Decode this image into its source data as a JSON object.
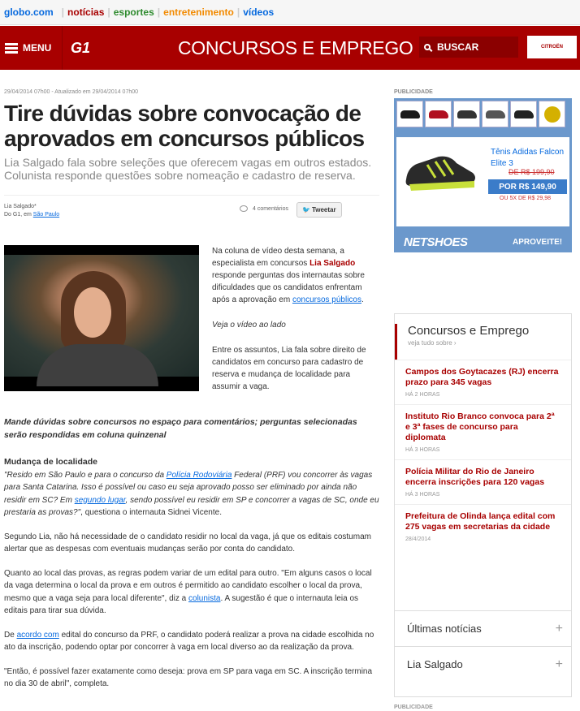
{
  "topnav": {
    "logo": "globo.com",
    "links": [
      {
        "label": "notícias",
        "color": "#a80000"
      },
      {
        "label": "esportes",
        "color": "#2d8a2d"
      },
      {
        "label": "entretenimento",
        "color": "#f28a00"
      },
      {
        "label": "vídeos",
        "color": "#0669de"
      }
    ]
  },
  "header": {
    "menu_label": "MENU",
    "brand": "G1",
    "section_title": "CONCURSOS E EMPREGO",
    "search_label": "BUSCAR",
    "ad_text": "CITROËN"
  },
  "article": {
    "date": "29/04/2014 07h00 - Atualizado em 29/04/2014 07h00",
    "title": "Tire dúvidas sobre convocação de aprovados em concursos públicos",
    "subtitle": "Lia Salgado fala sobre seleções que oferecem vagas em outros estados. Colunista responde questões sobre nomeação e cadastro de reserva.",
    "author": "Lia Salgado*",
    "source_prefix": "Do G1, em ",
    "source_city": "São Paulo",
    "comments": "4 comentários",
    "tweet": "Tweetar",
    "video_p1_a": "Na coluna de vídeo desta semana, a especialista em concursos ",
    "video_p1_name": "Lia Salgado",
    "video_p1_b": " responde perguntas dos internautas sobre dificuldades que os candidatos enfrentam após a aprovação em ",
    "video_p1_link": "concursos públicos",
    "video_p1_c": ".",
    "video_p2": "Veja o vídeo ao lado",
    "video_p3": "Entre os assuntos, Lia fala sobre direito de candidatos em concurso para cadastro de reserva e mudança de localidade para assumir a vaga.",
    "callout": "Mande dúvidas sobre concursos no espaço para comentários; perguntas selecionadas serão respondidas em coluna quinzenal",
    "h_mudanca": "Mudança de localidade",
    "q1_a": "\"Resido em São Paulo e para o concurso da ",
    "q1_link1": "Polícia Rodoviária",
    "q1_b": " Federal (PRF) vou concorrer às vagas para Santa Catarina. Isso é possível ou caso eu seja aprovado posso ser eliminado por ainda não residir em SC? Em ",
    "q1_link2": "segundo lugar",
    "q1_c": ", sendo possível eu residir em SP e concorrer a vagas de SC, onde eu prestaria as provas?\"",
    "q1_d": ", questiona o internauta Sidnei Vicente.",
    "p1": "Segundo Lia, não há necessidade de o candidato residir no local da vaga, já que os editais costumam alertar que as despesas com eventuais mudanças serão por conta do candidato.",
    "p2_a": "Quanto ao local das provas, as regras podem variar de um edital para outro. \"Em alguns casos o local da vaga determina o local da prova e em outros é permitido ao candidato escolher o local da prova, mesmo que a vaga seja para local diferente\", diz a ",
    "p2_link": "colunista",
    "p2_b": ". A sugestão é que o internauta leia os editais para tirar sua dúvida.",
    "p3_a": "De ",
    "p3_link": "acordo com",
    "p3_b": " edital do concurso da PRF, o candidato poderá realizar a prova na cidade escolhida no ato da inscrição, podendo optar por concorrer à vaga em local diverso ao da realização da prova.",
    "p4": "\"Então, é possível fazer exatamente como deseja: prova em SP para vaga em SC. A inscrição termina no dia 30 de abril\", completa."
  },
  "sidebar": {
    "pub_label": "PUBLICIDADE",
    "ad": {
      "product": "Tênis Adidas Falcon Elite 3",
      "old_price": "DE R$ 199,90",
      "price": "POR R$ 149,90",
      "installments": "OU 5X DE R$ 29,98",
      "brand": "NETSHOES",
      "cta": "APROVEITE!",
      "thumb_colors": [
        "#1a1a1a",
        "#b01020",
        "#333333",
        "#555555",
        "#222222",
        "#d4b000"
      ]
    },
    "box_title": "Concursos e Emprego",
    "box_more": "veja tudo sobre ›",
    "news": [
      {
        "title": "Campos dos Goytacazes (RJ) encerra prazo para 345 vagas",
        "time": "HÁ 2 HORAS"
      },
      {
        "title": "Instituto Rio Branco convoca para 2ª e 3ª fases de concurso para diplomata",
        "time": "HÁ 3 HORAS"
      },
      {
        "title": "Polícia Militar do Rio de Janeiro encerra inscrições para 120 vagas",
        "time": "HÁ 3 HORAS"
      },
      {
        "title": "Prefeitura de Olinda lança edital com 275 vagas em secretarias da cidade",
        "time": "28/4/2014"
      }
    ],
    "acc1": "Últimas notícias",
    "acc2": "Lia Salgado",
    "pub_label2": "PUBLICIDADE"
  }
}
